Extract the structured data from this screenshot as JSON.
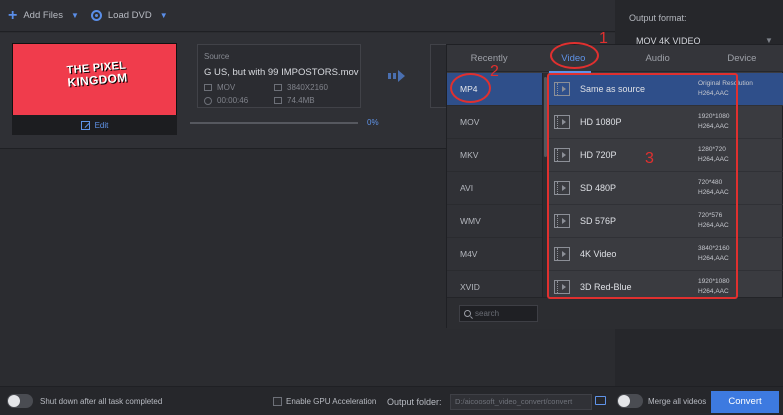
{
  "toolbar": {
    "add_files": "Add Files",
    "load_dvd": "Load DVD"
  },
  "output": {
    "label": "Output format:",
    "value": "MOV 4K VIDEO"
  },
  "job": {
    "thumb_text_top": "THE PIXEL",
    "thumb_text_bottom": "KINGDOM",
    "edit": "Edit",
    "source_label": "Source",
    "filename": "G US, but with 99 IMPOSTORS.mov",
    "container": "MOV",
    "resolution": "3840X2160",
    "duration": "00:00:46",
    "size": "74.4MB",
    "progress": "0%"
  },
  "dropdown": {
    "tabs": [
      "Recently",
      "Video",
      "Audio",
      "Device"
    ],
    "active_tab": "Video",
    "formats": [
      "MP4",
      "MOV",
      "MKV",
      "AVI",
      "WMV",
      "M4V",
      "XVID"
    ],
    "selected_format": "MP4",
    "presets": [
      {
        "name": "Same as source",
        "spec1": "Original Resolution",
        "spec2": "H264,AAC"
      },
      {
        "name": "HD 1080P",
        "spec1": "1920*1080",
        "spec2": "H264,AAC"
      },
      {
        "name": "HD 720P",
        "spec1": "1280*720",
        "spec2": "H264,AAC"
      },
      {
        "name": "SD 480P",
        "spec1": "720*480",
        "spec2": "H264,AAC"
      },
      {
        "name": "SD 576P",
        "spec1": "720*576",
        "spec2": "H264,AAC"
      },
      {
        "name": "4K Video",
        "spec1": "3840*2160",
        "spec2": "H264,AAC"
      },
      {
        "name": "3D Red-Blue",
        "spec1": "1920*1080",
        "spec2": "H264,AAC"
      }
    ],
    "search_placeholder": "search"
  },
  "annotations": {
    "n1": "1",
    "n2": "2",
    "n3": "3",
    "color": "#e0302f"
  },
  "bottom": {
    "shutdown": "Shut down after all task completed",
    "gpu": "Enable GPU Acceleration",
    "output_folder_label": "Output folder:",
    "output_folder_path": "D:/aicoosoft_video_convert/convert",
    "merge": "Merge all videos",
    "convert": "Convert"
  },
  "colors": {
    "accent": "#3d7ae0",
    "selected": "#2f4f8a",
    "thumbnail": "#f03c4c"
  }
}
